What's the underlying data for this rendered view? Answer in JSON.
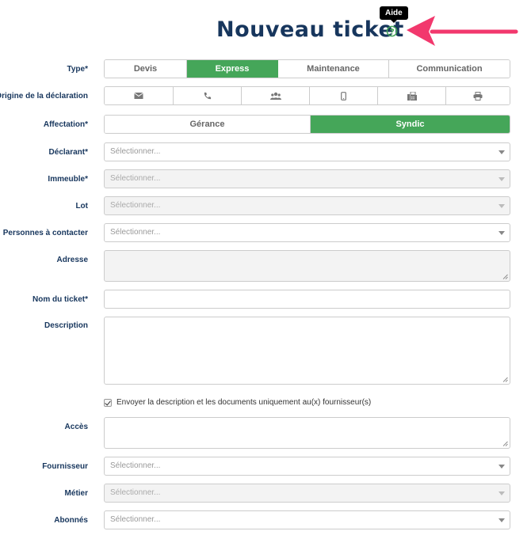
{
  "header": {
    "title": "Nouveau ticket",
    "help_tooltip": "Aide",
    "accent_color": "#17365d"
  },
  "form": {
    "type": {
      "label": "Type*",
      "options": [
        "Devis",
        "Express",
        "Maintenance",
        "Communication"
      ],
      "selected": "Express"
    },
    "origine": {
      "label": "Origine de la déclaration",
      "icons": [
        "envelope-icon",
        "phone-icon",
        "users-icon",
        "mobile-icon",
        "fax-icon",
        "print-icon"
      ]
    },
    "affectation": {
      "label": "Affectation*",
      "options": [
        "Gérance",
        "Syndic"
      ],
      "selected": "Syndic"
    },
    "declarant": {
      "label": "Déclarant*",
      "placeholder": "Sélectionner..."
    },
    "immeuble": {
      "label": "Immeuble*",
      "placeholder": "Sélectionner..."
    },
    "lot": {
      "label": "Lot",
      "placeholder": "Sélectionner..."
    },
    "personnes": {
      "label": "Personnes à contacter",
      "placeholder": "Sélectionner..."
    },
    "adresse": {
      "label": "Adresse"
    },
    "nom_ticket": {
      "label": "Nom du ticket*"
    },
    "description": {
      "label": "Description"
    },
    "envoyer": {
      "label": "Envoyer la description et les documents uniquement au(x) fournisseur(s)",
      "checked": true
    },
    "acces": {
      "label": "Accès"
    },
    "fournisseur": {
      "label": "Fournisseur",
      "placeholder": "Sélectionner..."
    },
    "metier": {
      "label": "Métier",
      "placeholder": "Sélectionner..."
    },
    "abonnes": {
      "label": "Abonnés",
      "placeholder": "Sélectionner..."
    }
  },
  "colors": {
    "active_green": "#45a659",
    "label_navy": "#17365d",
    "arrow_pink": "#f2386d"
  }
}
